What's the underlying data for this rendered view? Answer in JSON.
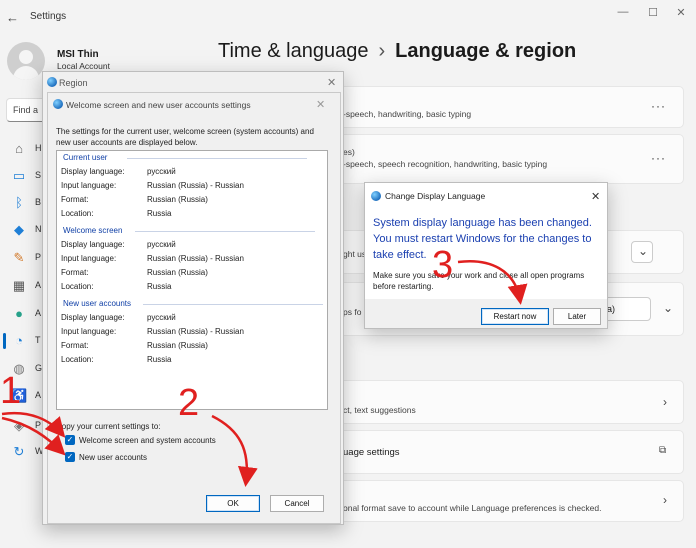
{
  "window": {
    "title": "Settings",
    "minimize": "—",
    "maximize": "☐",
    "close": "✕",
    "back_glyph": "←"
  },
  "account": {
    "name": "MSI Thin",
    "type": "Local Account"
  },
  "search": {
    "placeholder": "Find a"
  },
  "header": {
    "parent": "Time & language",
    "separator": "›",
    "current": "Language & region"
  },
  "nav_icons": [
    "home-icon",
    "system-icon",
    "bluetooth-icon",
    "network-icon",
    "personalization-icon",
    "apps-icon",
    "accounts-icon",
    "time-language-icon",
    "gaming-icon",
    "accessibility-icon",
    "privacy-icon",
    "update-icon"
  ],
  "nav_letters": [
    "H",
    "S",
    "B",
    "N",
    "P",
    "A",
    "A",
    "T",
    "G",
    "A",
    "P",
    "W"
  ],
  "cards": [
    {
      "text": "-speech, handwriting, basic typing",
      "action": "···"
    },
    {
      "text_top": "es)",
      "text": "-speech, speech recognition, handwriting, basic typing",
      "action": "···"
    },
    {
      "text": "ght us"
    },
    {
      "text": "ps fo",
      "dropdown": "ssia)"
    },
    {
      "text": "ct, text suggestions"
    },
    {
      "text": "uage settings"
    },
    {
      "text": "onal format save to account while Language preferences is checked."
    }
  ],
  "region": {
    "title": "Region",
    "inner_title": "Welcome screen and new user accounts settings",
    "description": "The settings for the current user, welcome screen (system accounts) and new user accounts are displayed below.",
    "groups": [
      {
        "name": "Current user",
        "rows": [
          {
            "label": "Display language:",
            "value": "русский"
          },
          {
            "label": "Input language:",
            "value": "Russian (Russia) - Russian"
          },
          {
            "label": "Format:",
            "value": "Russian (Russia)"
          },
          {
            "label": "Location:",
            "value": "Russia"
          }
        ]
      },
      {
        "name": "Welcome screen",
        "rows": [
          {
            "label": "Display language:",
            "value": "русский"
          },
          {
            "label": "Input language:",
            "value": "Russian (Russia) - Russian"
          },
          {
            "label": "Format:",
            "value": "Russian (Russia)"
          },
          {
            "label": "Location:",
            "value": "Russia"
          }
        ]
      },
      {
        "name": "New user accounts",
        "rows": [
          {
            "label": "Display language:",
            "value": "русский"
          },
          {
            "label": "Input language:",
            "value": "Russian (Russia) - Russian"
          },
          {
            "label": "Format:",
            "value": "Russian (Russia)"
          },
          {
            "label": "Location:",
            "value": "Russia"
          }
        ]
      }
    ],
    "copy_label": "Copy your current settings to:",
    "checkbox1": {
      "label": "Welcome screen and system accounts",
      "checked": true
    },
    "checkbox2": {
      "label": "New user accounts",
      "checked": true
    },
    "ok": "OK",
    "cancel": "Cancel"
  },
  "change_dialog": {
    "title": "Change Display Language",
    "message": "System display language has been changed. You must restart Windows for the changes to take effect.",
    "note": "Make sure you save your work and close all open programs before restarting.",
    "restart": "Restart now",
    "later": "Later"
  },
  "annotations": {
    "n1": "1",
    "n2": "2",
    "n3": "3",
    "color": "#e0201f"
  }
}
